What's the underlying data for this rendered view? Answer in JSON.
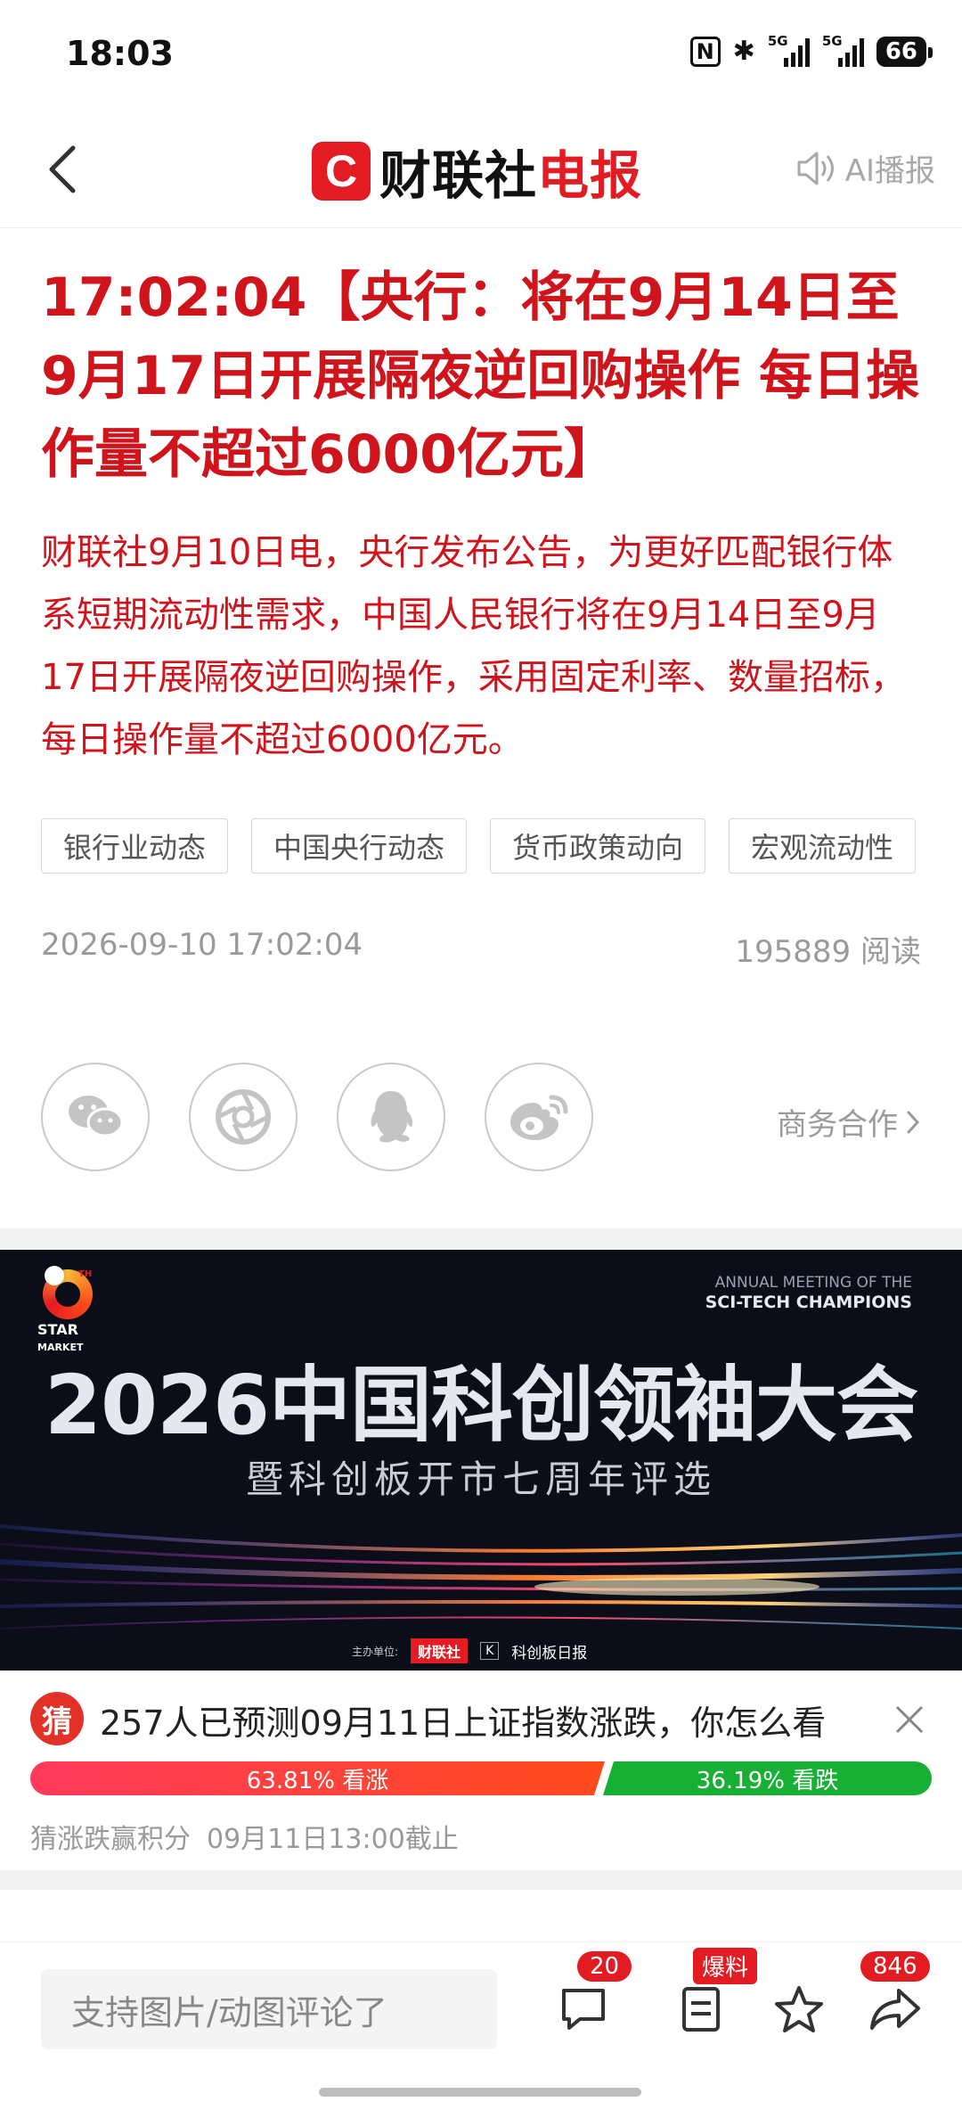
{
  "status_bar": {
    "time": "18:03",
    "nfc": "N",
    "bluetooth": "✱",
    "signal1_label": "5G",
    "signal2_label": "5G",
    "battery": "66"
  },
  "header": {
    "back_icon": "chevron-left-icon",
    "logo_mark": "C",
    "logo_text_black": "财联社",
    "logo_text_red": "电报",
    "ai_label": "AI播报"
  },
  "article": {
    "headline": "17:02:04【央行：将在9月14日至9月17日开展隔夜逆回购操作 每日操作量不超过6000亿元】",
    "summary": "财联社9月10日电，央行发布公告，为更好匹配银行体系短期流动性需求，中国人民银行将在9月14日至9月17日开展隔夜逆回购操作，采用固定利率、数量招标，每日操作量不超过6000亿元。",
    "tags": [
      "银行业动态",
      "中国央行动态",
      "货币政策动向",
      "宏观流动性"
    ],
    "date": "2026-09-10 17:02:04",
    "reads": "195889 阅读"
  },
  "share": {
    "icons": [
      "wechat-icon",
      "moments-icon",
      "qq-icon",
      "weibo-icon"
    ],
    "business_label": "商务合作"
  },
  "banner": {
    "star_label_1": "STAR",
    "star_label_2": "MARKET",
    "star_th": "TH",
    "en_line1": "ANNUAL MEETING OF THE",
    "en_line2": "SCI-TECH CHAMPIONS",
    "title": "2026中国科创领袖大会",
    "subtitle": "暨科创板开市七周年评选",
    "sponsor_prefix": "主办单位:",
    "sponsor_a": "财联社",
    "sponsor_b": "科创板日报"
  },
  "prediction": {
    "badge": "猜",
    "question": "257人已预测09月11日上证指数涨跌，你怎么看",
    "up_label": "63.81% 看涨",
    "down_label": "36.19% 看跌",
    "up_fraction": 0.6381,
    "down_fraction": 0.3619,
    "foot_left": "猜涨跌赢积分",
    "foot_right": "09月11日13:00截止"
  },
  "bottom_bar": {
    "comment_placeholder": "支持图片/动图评论了",
    "comment_count": "20",
    "scoop_label": "爆料",
    "share_count": "846"
  },
  "colors": {
    "brand_red": "#e31b23",
    "headline_red": "#d0141c",
    "down_green": "#17b035"
  }
}
